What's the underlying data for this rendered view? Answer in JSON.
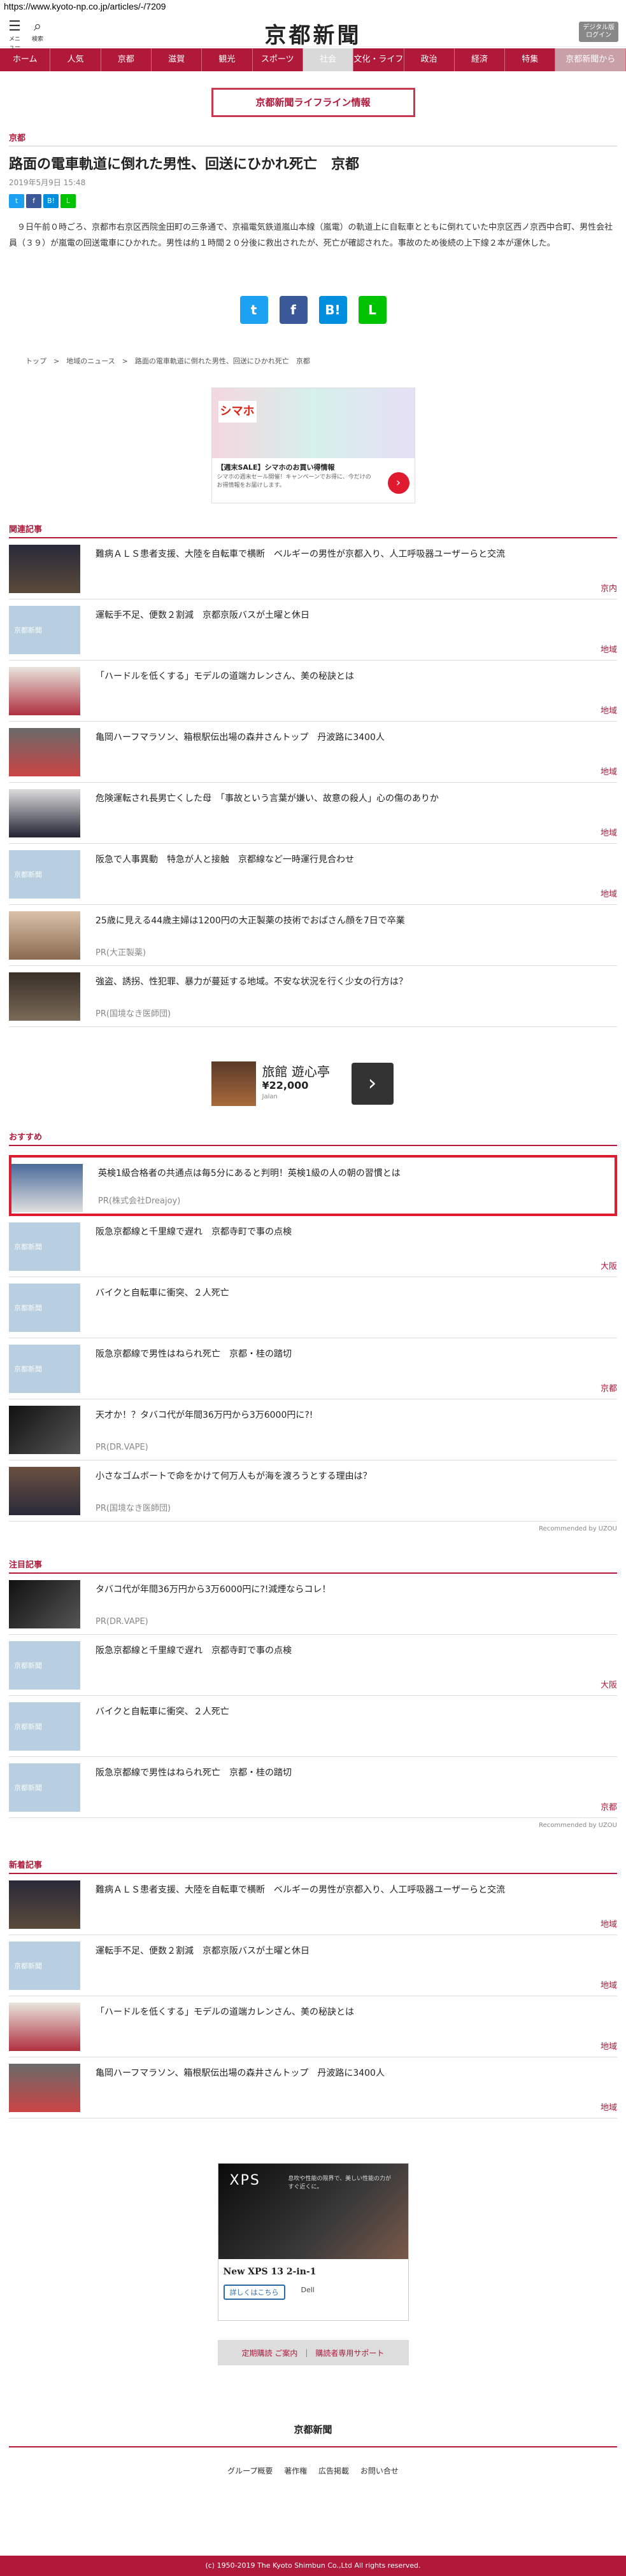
{
  "url": "https://www.kyoto-np.co.jp/articles/-/7209",
  "header": {
    "menu_label": "メニュー",
    "search_label": "検索",
    "logo": "京都新聞",
    "digital_label_1": "デジタル版",
    "digital_label_2": "ログイン"
  },
  "nav": [
    "ホーム",
    "人気",
    "京都",
    "滋賀",
    "観光",
    "スポーツ",
    "社会",
    "文化・ライフ",
    "政治",
    "経済",
    "特集",
    "京都新聞から"
  ],
  "life_banner": "京都新聞ライフライン情報",
  "article": {
    "category": "京都",
    "title": "路面の電車軌道に倒れた男性、回送にひかれ死亡　京都",
    "date": "2019年5月9日 15:48",
    "body": "　９日午前０時ごろ、京都市右京区西院金田町の三条通で、京福電気鉄道嵐山本線（嵐電）の軌道上に自転車とともに倒れていた中京区西ノ京西中合町、男性会社員（３９）が嵐電の回送電車にひかれた。男性は約１時間２０分後に救出されたが、死亡が確認された。事故のため後続の上下線２本が運休した。"
  },
  "share_small": [
    "t",
    "f",
    "B!",
    "L"
  ],
  "share_big": [
    "t",
    "f",
    "B!",
    "L"
  ],
  "breadcrumb": "トップ　>　地域のニュース　>　路面の電車軌道に倒れた男性、回送にひかれ死亡　京都",
  "ad1": {
    "caption": "【週末SALE】シマホのお買い得情報",
    "desc": "シマホの週末セール開催！キャンペーンでお得に、今だけのお得情報をお届けします。",
    "brand": "シマホ"
  },
  "related": {
    "heading": "関連記事",
    "items": [
      {
        "text": "難病ＡＬＳ患者支援、大陸を自転車で横断　ベルギーの男性が京都入り、人工呼吸器ユーザーらと交流",
        "label": "京内"
      },
      {
        "text": "運転手不足、便数２割減　京都京阪バスが土曜と休日",
        "label": "地域"
      },
      {
        "text": "「ハードルを低くする」モデルの道端カレンさん、美の秘訣とは",
        "label": "地域"
      },
      {
        "text": "亀岡ハーフマラソン、箱根駅伝出場の森井さんトップ　丹波路に3400人",
        "label": "地域"
      },
      {
        "text": "危険運転され長男亡くした母　「事故という言葉が嫌い、故意の殺人」心の傷のありか",
        "label": "地域"
      },
      {
        "text": "阪急で人事異動　特急が人と接触　京都線など一時運行見合わせ",
        "label": "地域"
      },
      {
        "text": "25歳に見える44歳主婦は1200円の大正製薬の技術でおばさん顔を7日で卒業",
        "pr": "PR(大正製薬)"
      },
      {
        "text": "強盗、誘拐、性犯罪、暴力が蔓延する地域。不安な状況を行く少女の行方は？",
        "pr": "PR(国境なき医師団)"
      }
    ]
  },
  "ad2": {
    "title": "旅館 遊心亭",
    "price": "¥22,000",
    "sub": "Jalan"
  },
  "recommend": {
    "heading": "おすすめ",
    "items": [
      {
        "text": "英検1級合格者の共通点は毎5分にあると判明！英検1級の人の朝の習慣とは",
        "pr": "PR(株式会社Dreajoy)"
      },
      {
        "text": "阪急京都線と千里線で遅れ　京都寺町で事の点検",
        "label": "大阪"
      },
      {
        "text": "バイクと自転車に衝突、２人死亡",
        "label": ""
      },
      {
        "text": "阪急京都線で男性はねられ死亡　京都・桂の踏切",
        "label": "京都"
      },
      {
        "text": "天才か！？タバコ代が年間36万円から3万6000円に?!",
        "pr": "PR(DR.VAPE)"
      },
      {
        "text": "小さなゴムボートで命をかけて何万人もが海を渡ろうとする理由は？",
        "pr": "PR(国境なき医師団)"
      }
    ],
    "credit": "Recommended by UZOU"
  },
  "featured": {
    "heading": "注目記事",
    "items": [
      {
        "text": "タバコ代が年間36万円から3万6000円に?!減煙ならコレ！",
        "pr": "PR(DR.VAPE)"
      },
      {
        "text": "阪急京都線と千里線で遅れ　京都寺町で事の点検",
        "label": "大阪"
      },
      {
        "text": "バイクと自転車に衝突、２人死亡",
        "label": ""
      },
      {
        "text": "阪急京都線で男性はねられ死亡　京都・桂の踏切",
        "label": "京都"
      }
    ],
    "credit": "Recommended by UZOU"
  },
  "latest": {
    "heading": "新着記事",
    "items": [
      {
        "text": "難病ＡＬＳ患者支援、大陸を自転車で横断　ベルギーの男性が京都入り、人工呼吸器ユーザーらと交流",
        "label": "地域"
      },
      {
        "text": "運転手不足、便数２割減　京都京阪バスが土曜と休日",
        "label": "地域"
      },
      {
        "text": "「ハードルを低くする」モデルの道端カレンさん、美の秘訣とは",
        "label": "地域"
      },
      {
        "text": "亀岡ハーフマラソン、箱根駅伝出場の森井さんトップ　丹波路に3400人",
        "label": "地域"
      }
    ]
  },
  "ad3": {
    "brand": "XPS",
    "headline": "息吹や性能の限界で、美しい性能の力がすぐ近くに。",
    "product": "New XPS 13 2-in-1",
    "cta": "詳しくはこちら",
    "maker": "Dell"
  },
  "help": {
    "a": "定期購読 ご案内",
    "b": "購読者専用サポート"
  },
  "footer": {
    "logo": "京都新聞",
    "links": [
      "グループ概要",
      "著作権",
      "広告掲載",
      "お問い合せ"
    ],
    "copyright": "(c) 1950-2019 The Kyoto Shimbun Co.,Ltd All rights reserved."
  },
  "colors": {
    "brand": "#b0193a",
    "highlight": "#e01b2f"
  }
}
